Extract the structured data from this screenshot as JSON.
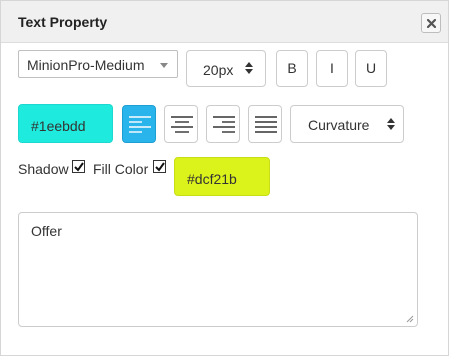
{
  "panel": {
    "title": "Text Property",
    "close_icon": "close-icon"
  },
  "font": {
    "family": "MinionPro-Medium",
    "size": "20px"
  },
  "style_buttons": {
    "bold": "B",
    "italic": "I",
    "underline": "U"
  },
  "text_color": {
    "value": "#1eebdd",
    "color": "#1eebdd"
  },
  "alignment": {
    "options": [
      "align-left-icon",
      "align-center-icon",
      "align-right-icon",
      "align-justify-icon"
    ],
    "selected": "align-left-icon",
    "active_color": "#29b4ec"
  },
  "curvature": {
    "label": "Curvature"
  },
  "shadow": {
    "label": "Shadow",
    "checked": true
  },
  "fill": {
    "label": "Fill Color",
    "checked": true,
    "value": "#dcf21b",
    "color": "#dcf21b"
  },
  "text": {
    "value": "Offer"
  }
}
